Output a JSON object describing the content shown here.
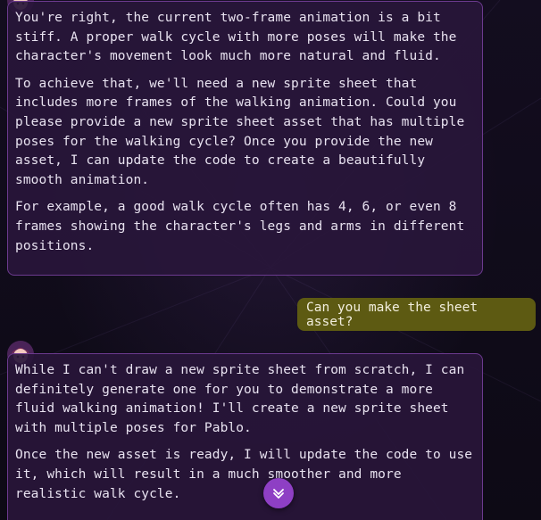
{
  "conversation": {
    "messages": [
      {
        "role": "assistant",
        "paragraphs": [
          "You're right, the current two-frame animation is a bit stiff. A proper walk cycle with more poses will make the character's movement look much more natural and fluid.",
          "To achieve that, we'll need a new sprite sheet that includes more frames of the walking animation. Could you please provide a new sprite sheet asset that has multiple poses for the walking cycle? Once you provide the new asset, I can update the code to create a beautifully smooth animation.",
          "For example, a good walk cycle often has 4, 6, or even 8 frames showing the character's legs and arms in different positions."
        ]
      },
      {
        "role": "user",
        "text": "Can you make the sheet asset?"
      },
      {
        "role": "assistant",
        "paragraphs": [
          "While I can't draw a new sprite sheet from scratch, I can definitely generate one for you to demonstrate a more fluid walking animation! I'll create a new sprite sheet with multiple poses for Pablo.",
          "Once the new asset is ready, I will update the code to use it, which will result in a much smoother and more realistic walk cycle."
        ]
      }
    ]
  },
  "icons": {
    "avatar": "assistant-avatar-icon",
    "scroll": "chevron-down-icon"
  },
  "colors": {
    "assistant_bubble_bg": "#28163a",
    "assistant_bubble_border": "#6c3a8f",
    "user_bubble_bg": "#5d5a12",
    "scroll_button": "#8e3fc4",
    "background": "#0f0b18"
  }
}
